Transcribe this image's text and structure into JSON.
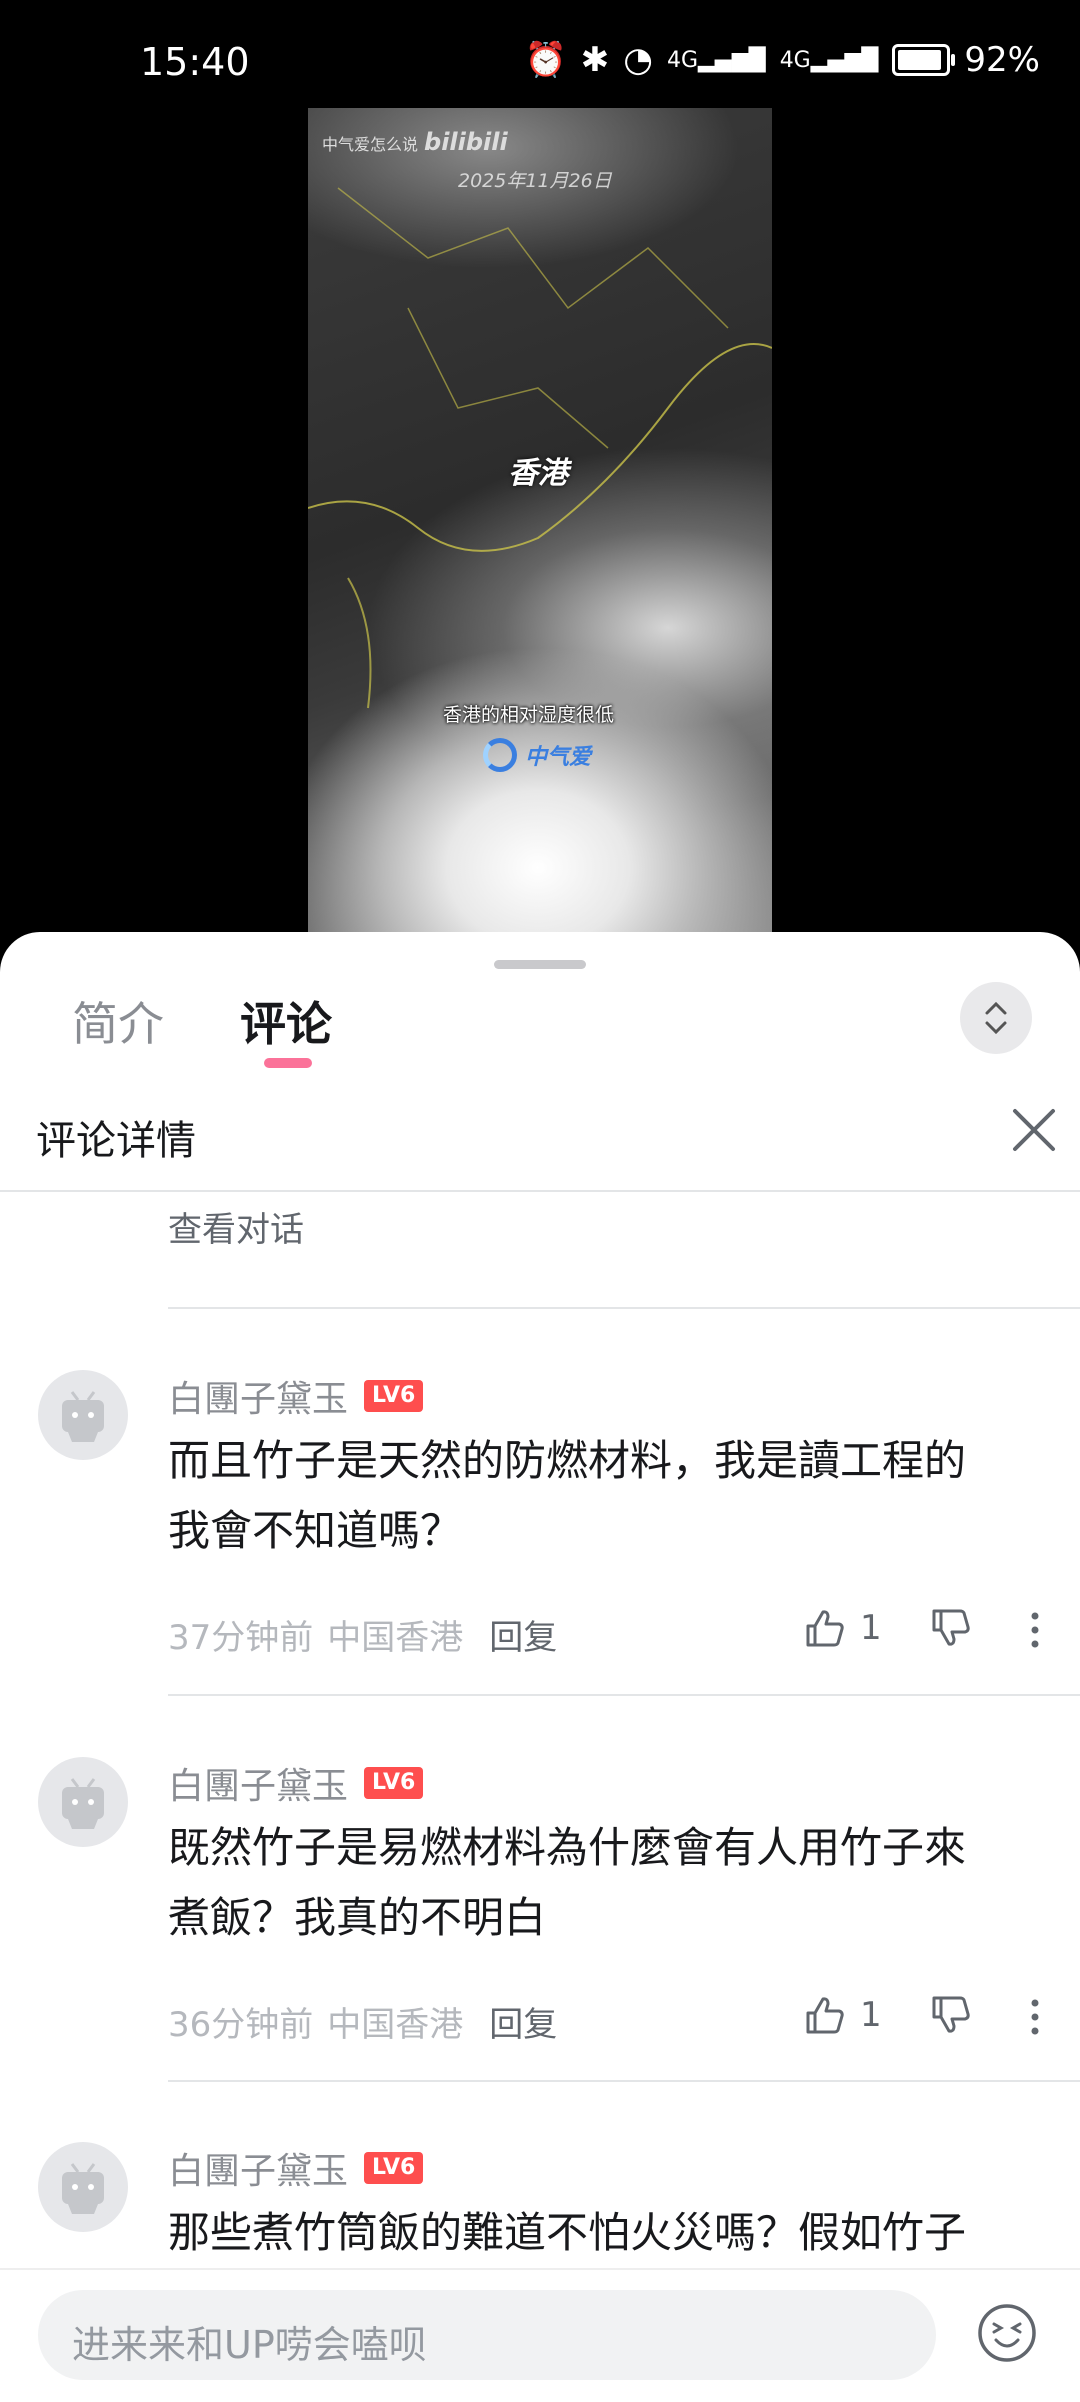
{
  "status": {
    "time": "15:40",
    "battery": "92%",
    "battery_level": 0.92,
    "sig1": "4G",
    "sig2": "4G"
  },
  "video": {
    "watermark": "中气爱怎么说",
    "watermark_brand": "bilibili",
    "date": "2025年11月26日",
    "city": "香港",
    "caption": "香港的相对湿度很低",
    "logo": "中气爱"
  },
  "tabs": {
    "intro": "简介",
    "comments": "评论"
  },
  "detail": {
    "title": "评论详情",
    "view_dialog": "查看对话"
  },
  "comments": [
    {
      "user": "白團子黛玉",
      "level": "LV6",
      "line1": "而且竹子是天然的防燃材料，我是讀工程的",
      "line2": "我會不知道嗎？",
      "time": "37分钟前",
      "location": "中国香港",
      "reply": "回复",
      "likes": "1"
    },
    {
      "user": "白團子黛玉",
      "level": "LV6",
      "line1": "既然竹子是易燃材料為什麼會有人用竹子來",
      "line2": "煮飯？我真的不明白",
      "time": "36分钟前",
      "location": "中国香港",
      "reply": "回复",
      "likes": "1"
    },
    {
      "user": "白團子黛玉",
      "level": "LV6",
      "line1": "那些煮竹筒飯的難道不怕火災嗎？假如竹子",
      "line2": ""
    }
  ],
  "input": {
    "placeholder": "进来来和UP唠会嗑呗"
  },
  "colors": {
    "accent": "#fb7299",
    "level_badge": "#fe4e4e"
  }
}
